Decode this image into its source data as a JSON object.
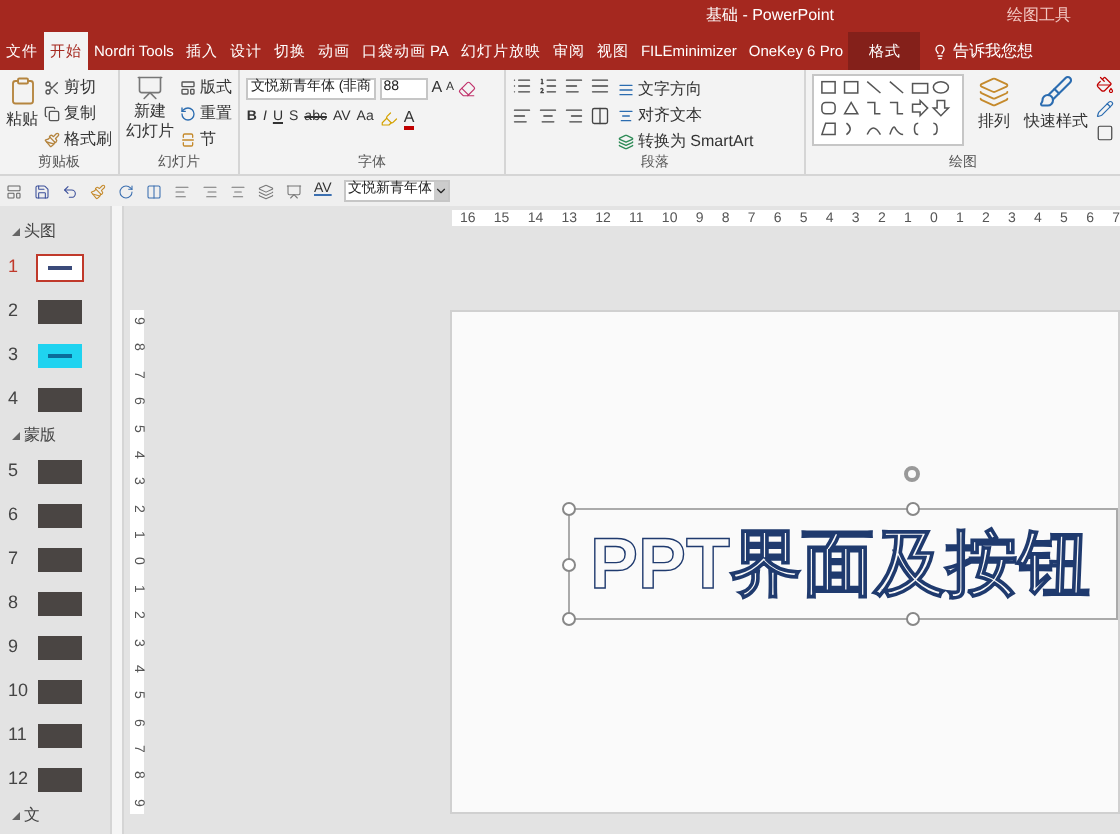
{
  "title_bar": {
    "document_title": "基础 - PowerPoint",
    "context_label": "绘图工具"
  },
  "tabs": [
    {
      "label": "文件",
      "selected": false,
      "kind": "normal"
    },
    {
      "label": "开始",
      "selected": true,
      "kind": "normal"
    },
    {
      "label": "Nordri Tools",
      "selected": false,
      "kind": "normal"
    },
    {
      "label": "插入",
      "selected": false,
      "kind": "normal"
    },
    {
      "label": "设计",
      "selected": false,
      "kind": "normal"
    },
    {
      "label": "切换",
      "selected": false,
      "kind": "normal"
    },
    {
      "label": "动画",
      "selected": false,
      "kind": "normal"
    },
    {
      "label": "口袋动画 PA",
      "selected": false,
      "kind": "normal"
    },
    {
      "label": "幻灯片放映",
      "selected": false,
      "kind": "normal"
    },
    {
      "label": "审阅",
      "selected": false,
      "kind": "normal"
    },
    {
      "label": "视图",
      "selected": false,
      "kind": "normal"
    },
    {
      "label": "FILEminimizer",
      "selected": false,
      "kind": "normal"
    },
    {
      "label": "OneKey 6 Pro",
      "selected": false,
      "kind": "normal"
    },
    {
      "label": "格式",
      "selected": false,
      "kind": "contextual"
    }
  ],
  "tell_me": "告诉我您想",
  "ribbon": {
    "groups": [
      {
        "kind": "clipboard",
        "label": "剪贴板",
        "big": "粘贴",
        "items": [
          "剪切",
          "复制",
          "格式刷"
        ]
      },
      {
        "kind": "slides",
        "label": "幻灯片",
        "big": [
          "新建",
          "幻灯片"
        ],
        "items": [
          "版式",
          "重置",
          "节"
        ]
      },
      {
        "kind": "font",
        "label": "字体",
        "font_name": "文悦新青年体 (非商",
        "font_size": "88",
        "grow": "A",
        "shrink": "A",
        "style_buttons": [
          "B",
          "I",
          "U",
          "S",
          "abc",
          "AV",
          "Aa"
        ],
        "font_color": "A"
      },
      {
        "kind": "paragraph",
        "label": "段落",
        "commands": [
          "文字方向",
          "对齐文本",
          "转换为 SmartArt"
        ]
      },
      {
        "kind": "drawing",
        "label": "绘图",
        "buttons": [
          "排列",
          "快速样式"
        ]
      }
    ]
  },
  "quick_toolbar": {
    "spacing_label": "AV",
    "font_field": "文悦新青年体"
  },
  "slide_panel": {
    "sections": [
      {
        "title": "头图",
        "expanded": true,
        "slides": [
          {
            "number": "1",
            "selected": true,
            "kind": "title"
          },
          {
            "number": "2",
            "selected": false,
            "kind": "photo"
          },
          {
            "number": "3",
            "selected": false,
            "kind": "cyan"
          },
          {
            "number": "4",
            "selected": false,
            "kind": "photo"
          }
        ]
      },
      {
        "title": "蒙版",
        "expanded": true,
        "slides": [
          {
            "number": "5",
            "selected": false,
            "kind": "photo"
          },
          {
            "number": "6",
            "selected": false,
            "kind": "photo"
          },
          {
            "number": "7",
            "selected": false,
            "kind": "photo"
          },
          {
            "number": "8",
            "selected": false,
            "kind": "photo"
          },
          {
            "number": "9",
            "selected": false,
            "kind": "photo"
          },
          {
            "number": "10",
            "selected": false,
            "kind": "photo"
          },
          {
            "number": "11",
            "selected": false,
            "kind": "photo"
          },
          {
            "number": "12",
            "selected": false,
            "kind": "photo"
          }
        ]
      },
      {
        "title": "文",
        "expanded": true
      }
    ]
  },
  "rulers": {
    "horizontal": [
      "16",
      "15",
      "14",
      "13",
      "12",
      "11",
      "10",
      "9",
      "8",
      "7",
      "6",
      "5",
      "4",
      "3",
      "2",
      "1",
      "0",
      "1",
      "2",
      "3",
      "4",
      "5",
      "6",
      "7"
    ],
    "vertical": [
      "9",
      "8",
      "7",
      "6",
      "5",
      "4",
      "3",
      "2",
      "1",
      "0",
      "1",
      "2",
      "3",
      "4",
      "5",
      "6",
      "7",
      "8",
      "9"
    ]
  },
  "slide": {
    "title_text": "PPT界面及按钮"
  }
}
